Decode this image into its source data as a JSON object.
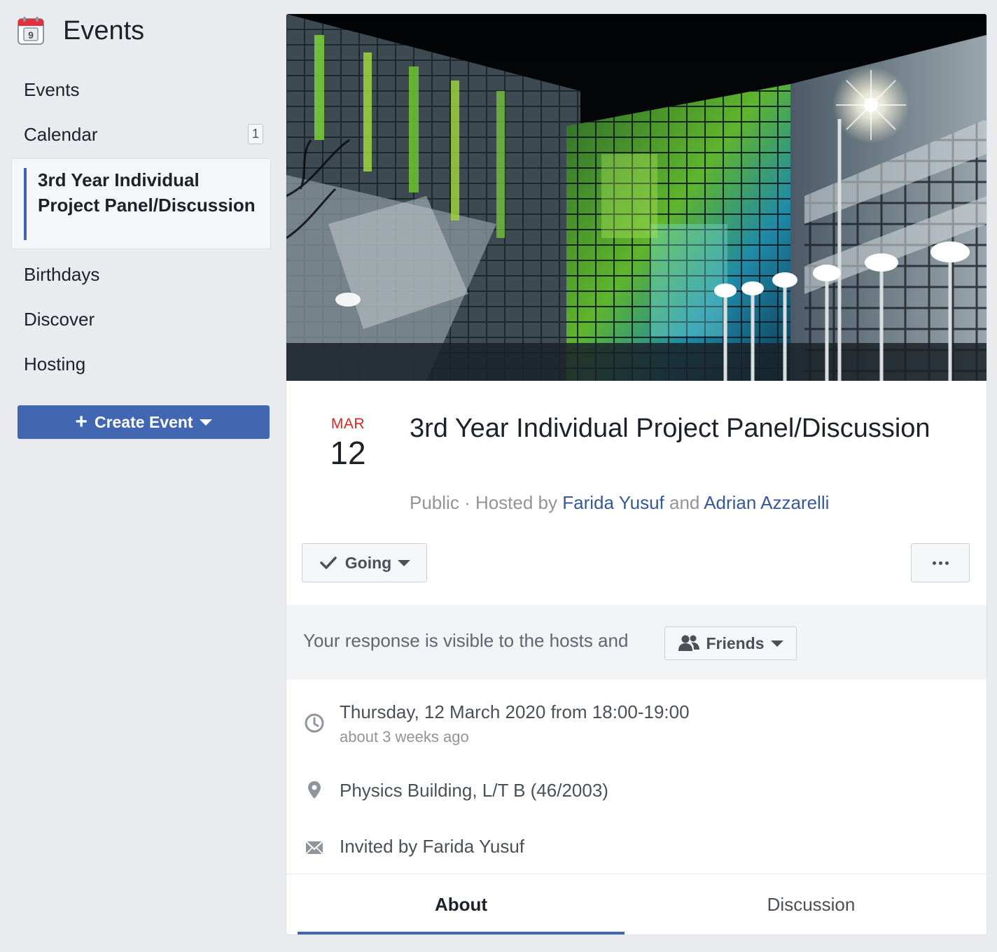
{
  "sidebar": {
    "header_title": "Events",
    "calendar_icon_day": "9",
    "items": [
      {
        "label": "Events"
      },
      {
        "label": "Calendar",
        "badge": "1"
      },
      {
        "label": "3rd Year Individual Project Panel/Discussion",
        "active": true
      },
      {
        "label": "Birthdays"
      },
      {
        "label": "Discover"
      },
      {
        "label": "Hosting"
      }
    ],
    "create_button": {
      "label": "Create Event",
      "icon": "plus-icon"
    }
  },
  "event": {
    "cover_image": "night photo of glass building with green lights",
    "month": "MAR",
    "day": "12",
    "title": "3rd Year Individual Project Panel/Discussion",
    "privacy": "Public",
    "hosted_by_prefix": "· Hosted by",
    "host_1": "Farida Yusuf",
    "and": "and",
    "host_2": "Adrian Azzarelli",
    "going_label": "Going",
    "more_label": "More options",
    "visibility_text": "Your response is visible to the hosts and",
    "friends_label": "Friends",
    "time_main": "Thursday, 12 March 2020 from 18:00-19:00",
    "time_sub": "about 3 weeks ago",
    "location": "Physics Building, L/T B (46/2003)",
    "invited_by": "Invited by Farida Yusuf"
  },
  "tabs": [
    {
      "label": "About",
      "active": true
    },
    {
      "label": "Discussion",
      "active": false
    }
  ],
  "colors": {
    "brand_blue": "#4267b2",
    "link_blue": "#365899",
    "month_red": "#e02424",
    "page_bg": "#e9ebee"
  }
}
